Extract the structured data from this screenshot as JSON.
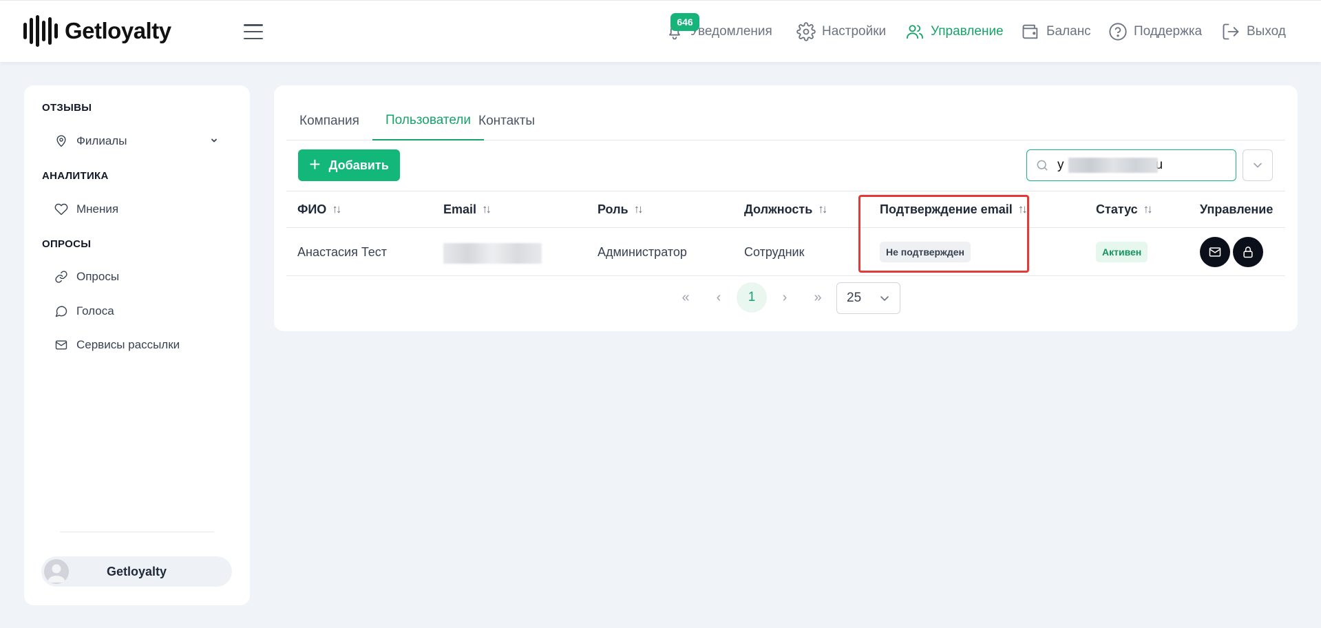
{
  "header": {
    "logo_text": "Getloyalty",
    "notifications_badge": "646",
    "nav": {
      "notifications": "Уведомления",
      "settings": "Настройки",
      "management": "Управление",
      "balance": "Баланс",
      "support": "Поддержка",
      "logout": "Выход"
    }
  },
  "sidebar": {
    "sections": {
      "reviews": "ОТЗЫВЫ",
      "analytics": "АНАЛИТИКА",
      "surveys": "ОПРОСЫ"
    },
    "items": {
      "branches": "Филиалы",
      "opinions": "Мнения",
      "polls": "Опросы",
      "votes": "Голоса",
      "mailing": "Сервисы рассылки"
    },
    "user_name": "Getloyalty"
  },
  "main": {
    "tabs": [
      "Компания",
      "Пользователи",
      "Контакты"
    ],
    "active_tab": "Пользователи",
    "add_button": "Добавить",
    "search_value": "y                        ru",
    "columns": [
      "ФИО",
      "Email",
      "Роль",
      "Должность",
      "Подтверждение email",
      "Статус",
      "Управление"
    ],
    "rows": [
      {
        "name": "Анастасия Тест",
        "email": "",
        "role": "Администратор",
        "position": "Сотрудник",
        "email_confirmation": "Не подтвержден",
        "status": "Активен"
      }
    ],
    "pagination": {
      "current_page": "1",
      "per_page": "25"
    }
  },
  "colors": {
    "accent": "#13b77a",
    "active_nav": "#16a368",
    "highlight": "#e53935"
  }
}
